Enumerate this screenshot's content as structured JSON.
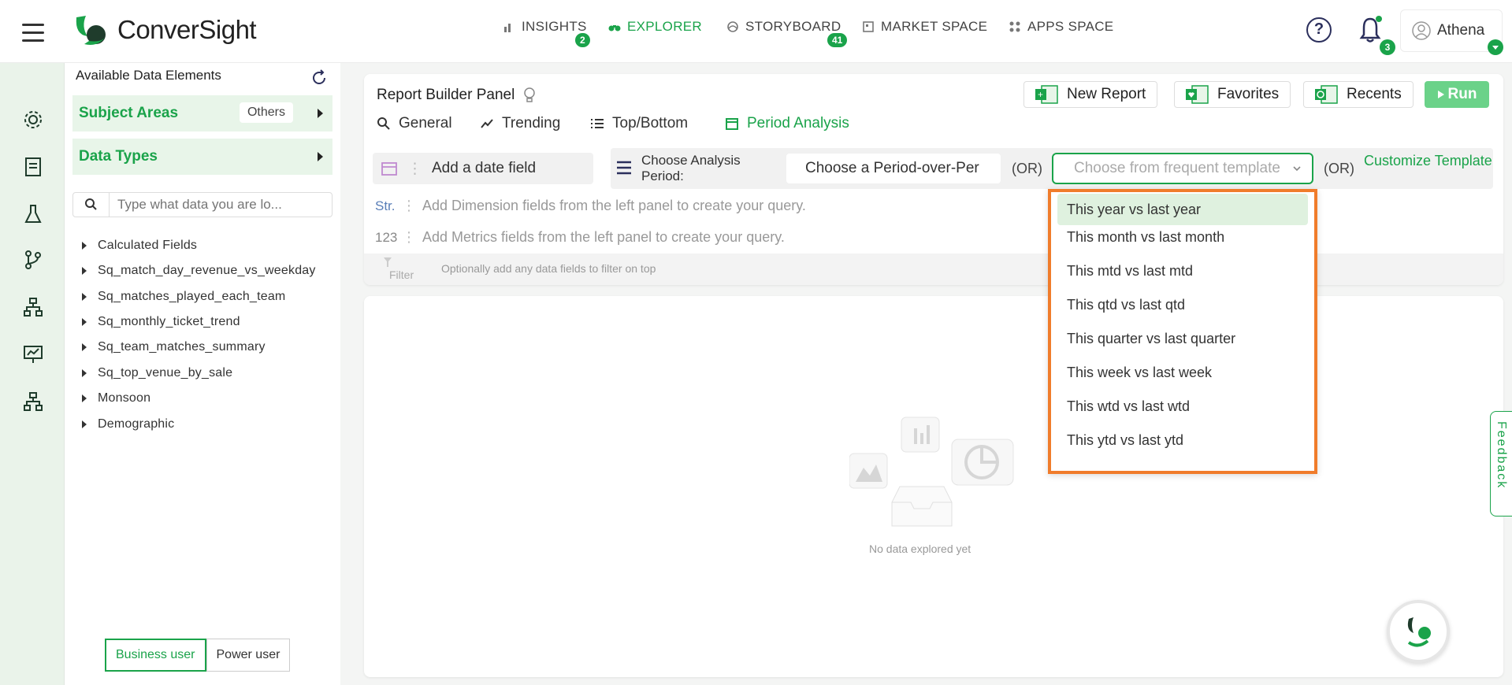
{
  "app": {
    "brand": "ConverSight",
    "user_name": "Athena",
    "notification_count": "3"
  },
  "nav": {
    "items": [
      {
        "label": "INSIGHTS",
        "badge": "2"
      },
      {
        "label": "EXPLORER",
        "badge": ""
      },
      {
        "label": "STORYBOARD",
        "badge": "41"
      },
      {
        "label": "MARKET SPACE",
        "badge": ""
      },
      {
        "label": "APPS SPACE",
        "badge": ""
      }
    ]
  },
  "left_panel": {
    "title": "Available Data Elements",
    "subject_areas_label": "Subject Areas",
    "subject_areas_value": "Others",
    "data_types_label": "Data Types",
    "search_placeholder": "Type what data you are lo...",
    "tree": [
      "Calculated Fields",
      "Sq_match_day_revenue_vs_weekday",
      "Sq_matches_played_each_team",
      "Sq_monthly_ticket_trend",
      "Sq_team_matches_summary",
      "Sq_top_venue_by_sale",
      "Monsoon",
      "Demographic"
    ],
    "modes": [
      "Business user",
      "Power user"
    ]
  },
  "report_builder": {
    "title": "Report Builder Panel",
    "tabs": [
      "General",
      "Trending",
      "Top/Bottom",
      "Period Analysis"
    ],
    "buttons": {
      "new_report": "New Report",
      "favorites": "Favorites",
      "recents": "Recents",
      "run": "Run"
    },
    "date_field": "Add a date field",
    "analysis_period_label": "Choose Analysis Period:",
    "period_select": "Choose a Period-over-Per",
    "or": "(OR)",
    "template_placeholder": "Choose from frequent template",
    "customize": "Customize Template",
    "dimension_tag": "Str.",
    "dimension_hint": "Add Dimension fields from the left panel to create your query.",
    "metric_tag": "123",
    "metric_hint": "Add Metrics fields from the left panel to create your query.",
    "filter_label": "Filter",
    "filter_hint": "Optionally add any data fields to filter on top"
  },
  "template_dropdown": {
    "options": [
      "This year vs last year",
      "This month vs last month",
      "This mtd vs last mtd",
      "This qtd vs last qtd",
      "This quarter vs last quarter",
      "This week vs last week",
      "This wtd vs last wtd",
      "This ytd vs last ytd"
    ],
    "selected_index": 0
  },
  "results": {
    "empty_text": "No data explored yet"
  },
  "feedback_label": "Feedback",
  "colors": {
    "accent": "#1aa34a",
    "highlight_border": "#f07c2b",
    "run_button": "#6bd289"
  }
}
